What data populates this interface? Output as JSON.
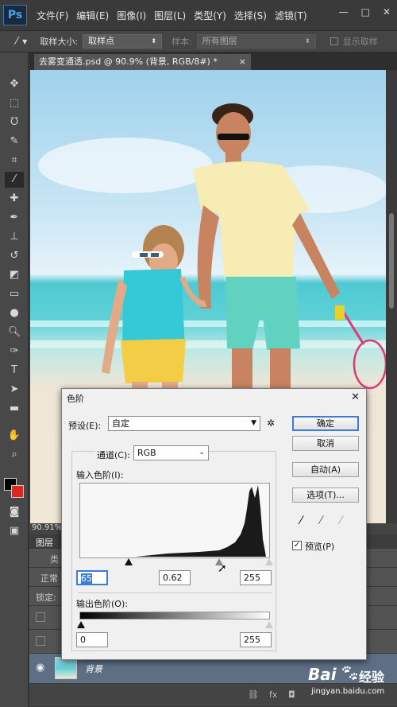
{
  "app": {
    "logo": "Ps"
  },
  "menu": [
    "文件(F)",
    "编辑(E)",
    "图像(I)",
    "图层(L)",
    "类型(Y)",
    "选择(S)",
    "滤镜(T)"
  ],
  "window_controls": {
    "minimize": "—",
    "restore": "□",
    "close": "✕"
  },
  "options_bar": {
    "sample_size_label": "取样大小:",
    "sample_size_value": "取样点",
    "sample_label": "样本:",
    "sample_value": "所有图层",
    "show_ring_label": "显示取样"
  },
  "document_tab": {
    "title": "去雾变通透.psd @ 90.9% (背景, RGB/8#) *",
    "close": "×"
  },
  "status": {
    "zoom": "90.91%"
  },
  "layers_panel": {
    "tab": "图层",
    "search": "类",
    "blend_mode": "正常",
    "lock_label": "锁定:",
    "layer_name": "背景"
  },
  "levels_dialog": {
    "title": "色阶",
    "close": "✕",
    "preset_label": "预设(E):",
    "preset_value": "自定",
    "channel_label": "通道(C):",
    "channel_value": "RGB",
    "input_levels_label": "输入色阶(I):",
    "input_black": "65",
    "input_gamma": "0.62",
    "input_white": "255",
    "output_levels_label": "输出色阶(O):",
    "output_black": "0",
    "output_white": "255",
    "ok": "确定",
    "cancel": "取消",
    "auto": "自动(A)",
    "options": "选项(T)...",
    "preview_label": "预览(P)",
    "preview_checked": true
  },
  "watermark": {
    "brand": "Bai",
    "brand2": "经验",
    "url": "jingyan.baidu.com"
  },
  "colors": {
    "foreground": "#000000",
    "background": "#e0271f",
    "accent": "#3d7bd6"
  }
}
